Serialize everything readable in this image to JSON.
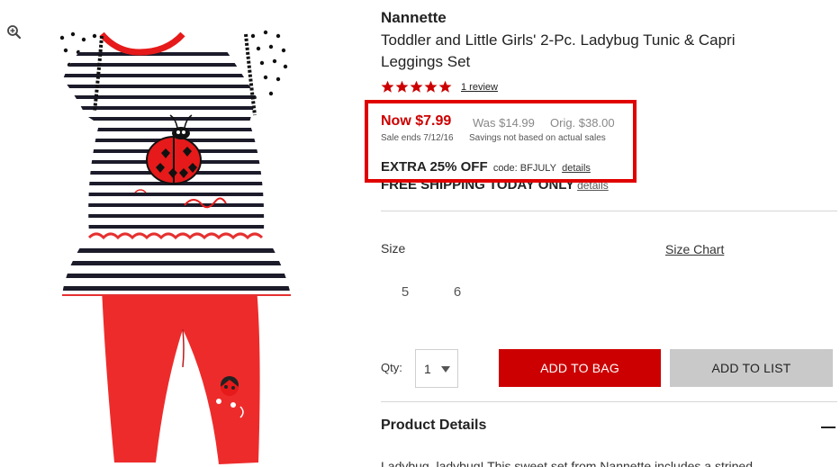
{
  "product": {
    "brand": "Nannette",
    "title": "Toddler and Little Girls' 2-Pc. Ladybug Tunic & Capri Leggings Set",
    "rating_stars": 5,
    "review_link": "1 review"
  },
  "pricing": {
    "now": "Now $7.99",
    "was": "Was $14.99",
    "orig": "Orig. $38.00",
    "sale_ends": "Sale ends 7/12/16",
    "savings_note": "Savings not based on actual sales",
    "extra_off": "EXTRA 25% OFF",
    "promo_code": "code: BFJULY",
    "promo_details": "details",
    "accent_color": "#cc0000"
  },
  "shipping": {
    "text": "FREE SHIPPING TODAY ONLY",
    "details": "details"
  },
  "size": {
    "label": "Size",
    "chart_link": "Size Chart",
    "options": [
      "5",
      "6"
    ]
  },
  "purchase": {
    "qty_label": "Qty:",
    "qty_value": "1",
    "add_to_bag": "ADD TO BAG",
    "add_to_list": "ADD TO LIST"
  },
  "details": {
    "title": "Product Details",
    "text_partial": "Ladybug, ladybug! This sweet set from Nannette includes a striped"
  },
  "icons": {
    "zoom": "zoom-in-icon",
    "star": "star-icon",
    "collapse": "minus-icon",
    "dropdown": "chevron-down-icon"
  }
}
